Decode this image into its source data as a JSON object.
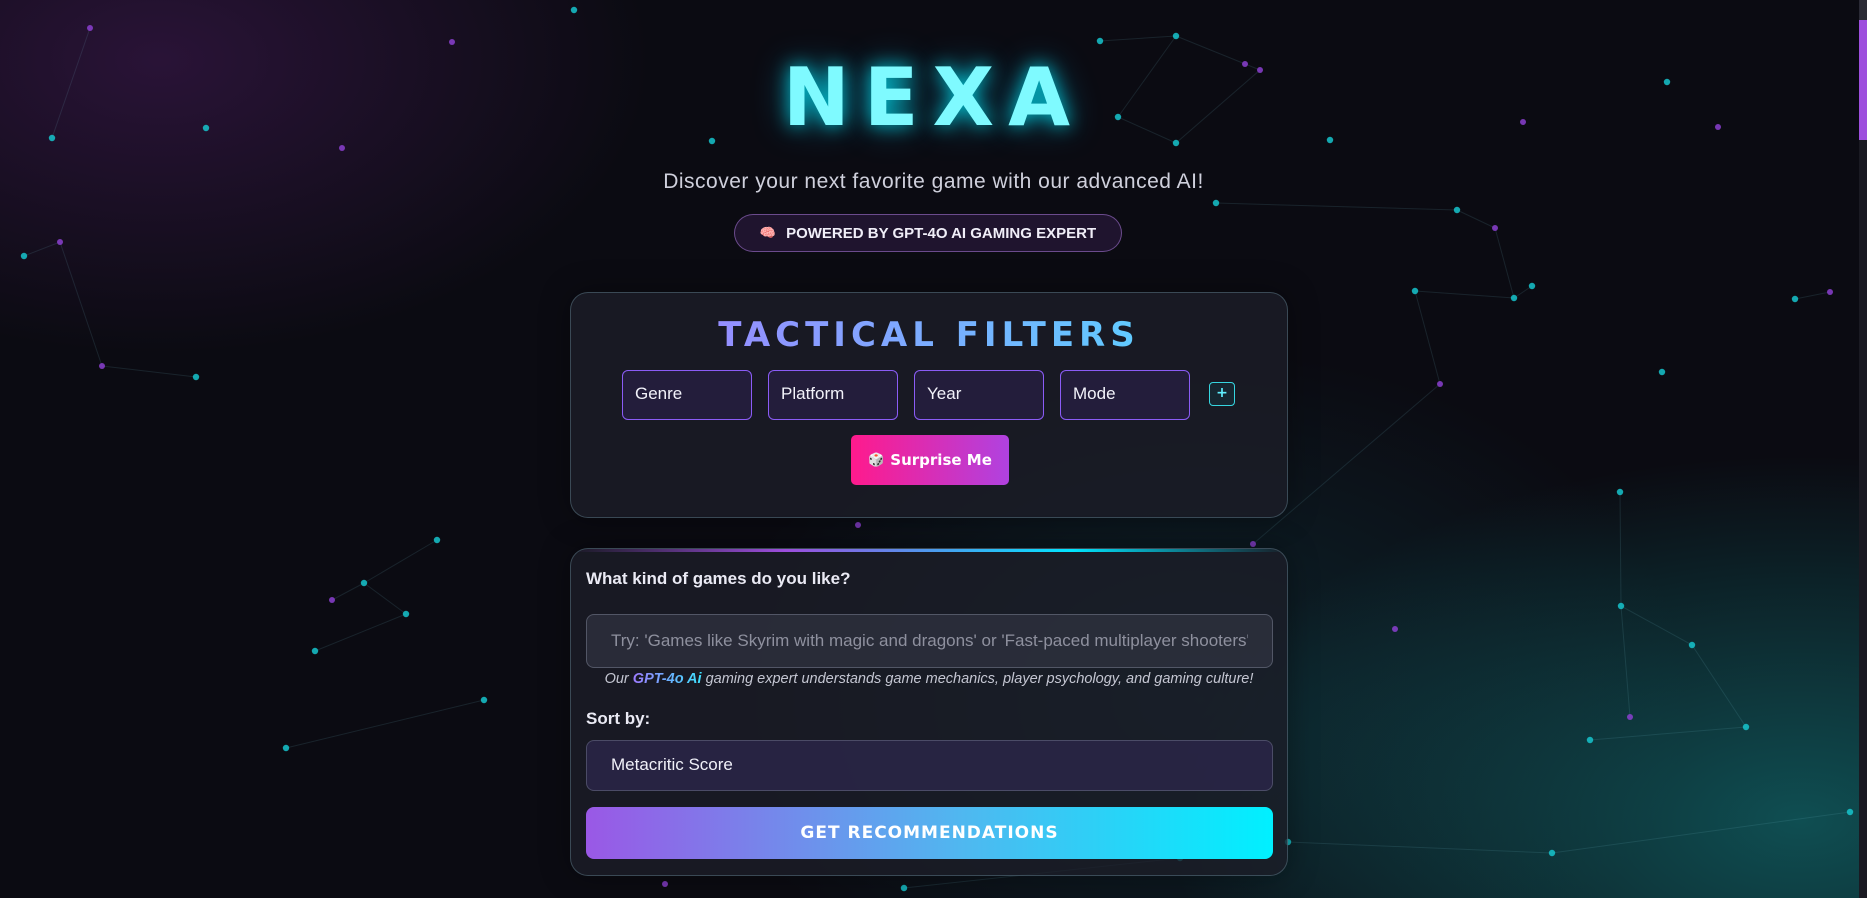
{
  "app": {
    "logo": "NEXA",
    "tagline": "Discover your next favorite game with our advanced AI!",
    "badge": {
      "icon": "brain-icon",
      "icon_glyph": "🧠",
      "label": "POWERED BY GPT-4O AI GAMING EXPERT"
    }
  },
  "filters": {
    "title": "TACTICAL FILTERS",
    "items": [
      {
        "label": "Genre"
      },
      {
        "label": "Platform"
      },
      {
        "label": "Year"
      },
      {
        "label": "Mode"
      }
    ],
    "add_label": "+",
    "surprise": {
      "icon": "dice-icon",
      "icon_glyph": "🎲",
      "label": "Surprise Me"
    }
  },
  "search": {
    "question": "What kind of games do you like?",
    "placeholder": "Try: 'Games like Skyrim with magic and dragons' or 'Fast-paced multiplayer shooters'",
    "value": "",
    "hint_prefix": "Our ",
    "hint_highlight": "GPT-4o Ai",
    "hint_suffix": " gaming expert understands game mechanics, player psychology, and gaming culture!",
    "sort_label": "Sort by:",
    "sort_value": "Metacritic Score",
    "submit_label": "GET RECOMMENDATIONS"
  },
  "colors": {
    "accent_cyan": "#00f0ff",
    "accent_purple": "#9d4edd",
    "accent_pink": "#ff1a8c",
    "background": "#0b0b12"
  }
}
